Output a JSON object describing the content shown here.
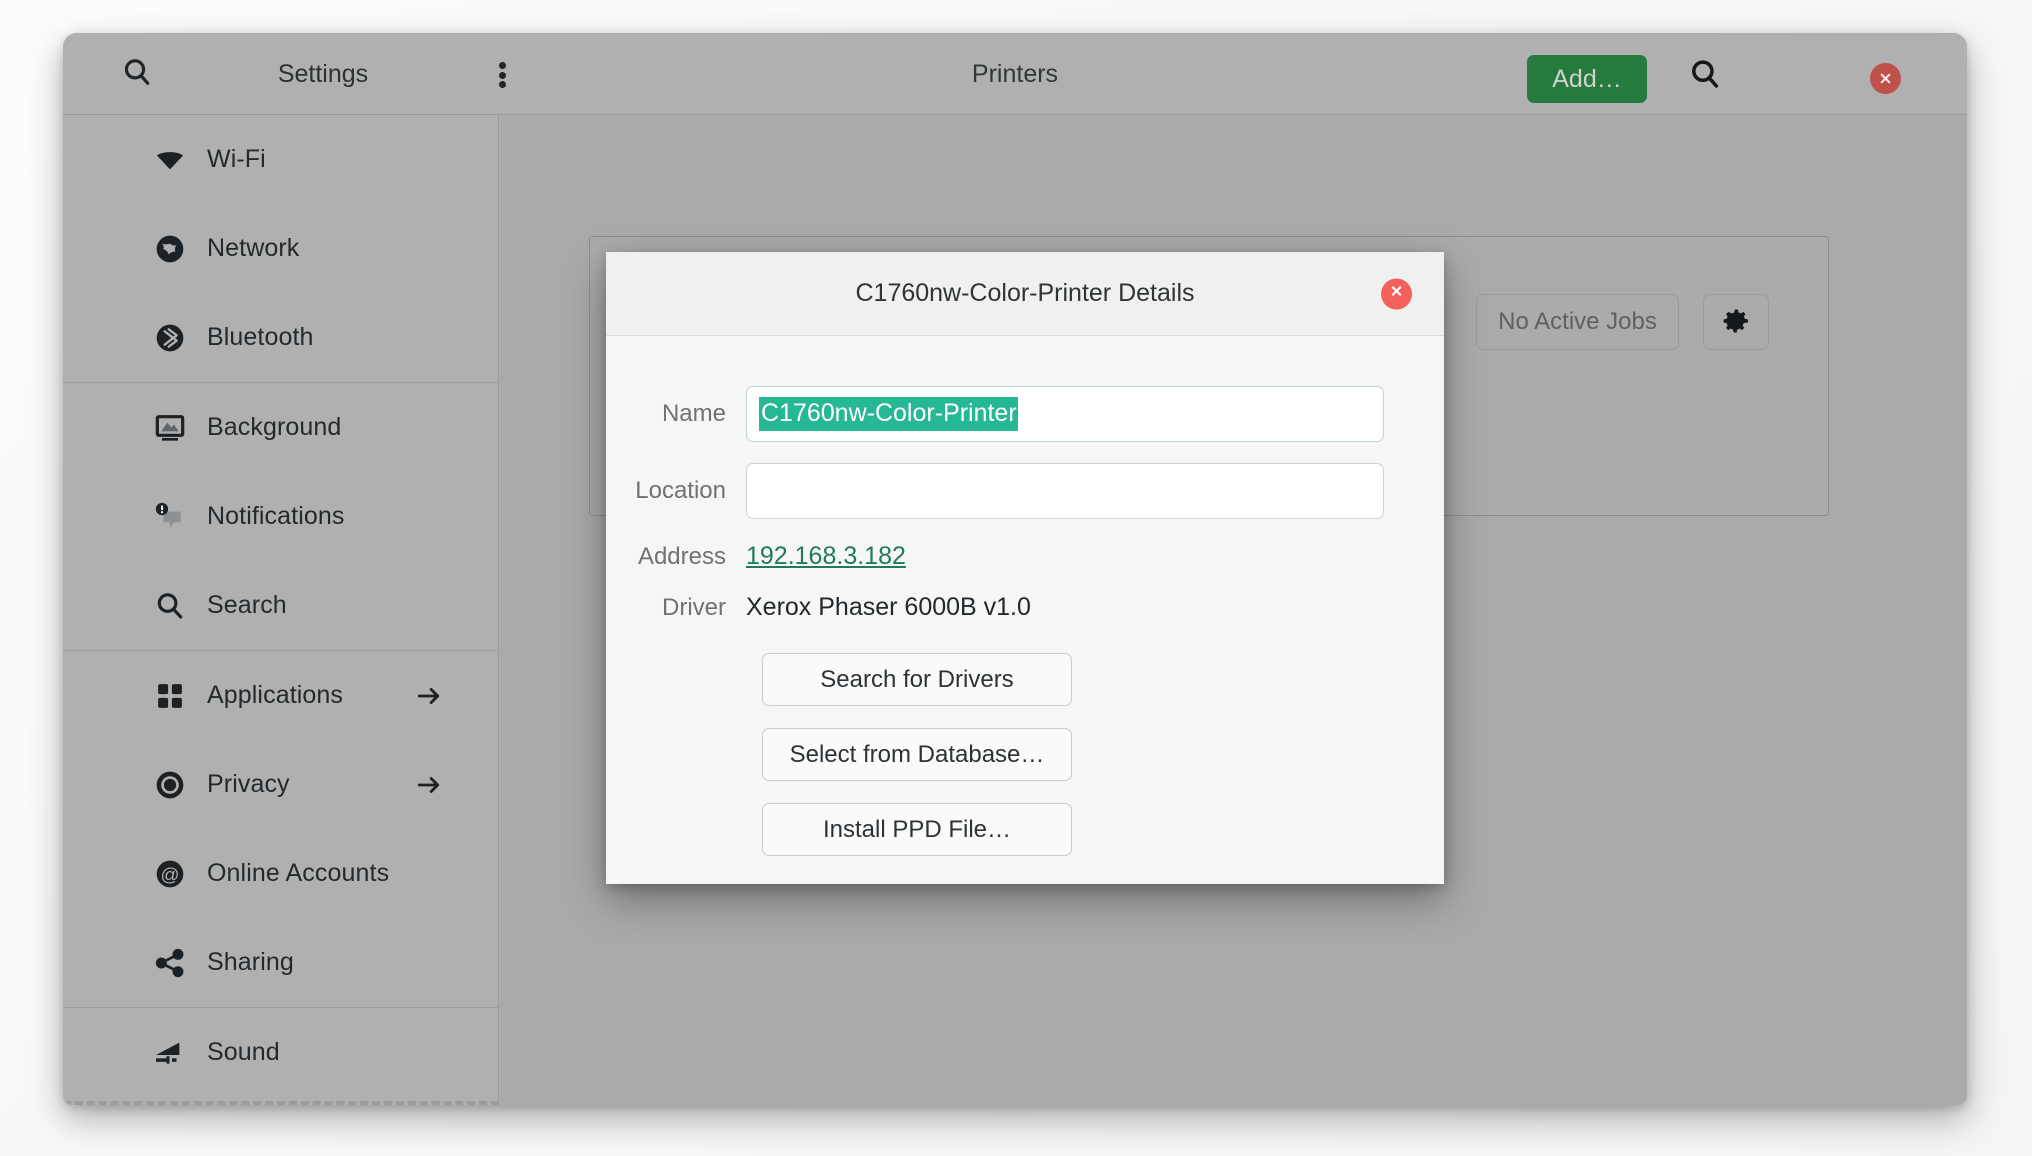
{
  "header": {
    "app_title": "Settings",
    "page_title": "Printers",
    "add_button": "Add…",
    "search_icon": "search-icon",
    "menu_icon": "kebab-menu-icon",
    "search_right_icon": "search-icon",
    "close_icon": "window-close-icon",
    "add_button_color": "#257a3e",
    "close_button_color": "#c0504a"
  },
  "sidebar": {
    "groups": [
      {
        "items": [
          {
            "label": "Wi-Fi",
            "icon": "wifi-icon",
            "arrow": false
          },
          {
            "label": "Network",
            "icon": "globe-icon",
            "arrow": false
          },
          {
            "label": "Bluetooth",
            "icon": "bluetooth-icon",
            "arrow": false
          }
        ]
      },
      {
        "items": [
          {
            "label": "Background",
            "icon": "monitor-icon",
            "arrow": false
          },
          {
            "label": "Notifications",
            "icon": "notification-bubble-icon",
            "arrow": false
          },
          {
            "label": "Search",
            "icon": "search-icon",
            "arrow": false
          }
        ]
      },
      {
        "items": [
          {
            "label": "Applications",
            "icon": "grid-squares-icon",
            "arrow": true
          },
          {
            "label": "Privacy",
            "icon": "target-circle-icon",
            "arrow": true
          },
          {
            "label": "Online Accounts",
            "icon": "at-sign-icon",
            "arrow": false
          },
          {
            "label": "Sharing",
            "icon": "share-nodes-icon",
            "arrow": false
          }
        ]
      },
      {
        "items": [
          {
            "label": "Sound",
            "icon": "volume-icon",
            "arrow": false
          }
        ]
      }
    ]
  },
  "content": {
    "jobs_button": "No Active Jobs",
    "gear_icon": "gear-icon"
  },
  "dialog": {
    "title": "C1760nw-Color-Printer Details",
    "close_icon": "dialog-close-icon",
    "close_color": "#f4615d",
    "selection_color": "#26b795",
    "link_color": "#1f7a5f",
    "fields": {
      "name_label": "Name",
      "name_value": "C1760nw-Color-Printer",
      "name_placeholder": "",
      "location_label": "Location",
      "location_value": "",
      "location_placeholder": "",
      "address_label": "Address",
      "address_value": "192.168.3.182",
      "driver_label": "Driver",
      "driver_value": "Xerox Phaser 6000B v1.0"
    },
    "buttons": [
      "Search for Drivers",
      "Select from Database…",
      "Install PPD File…"
    ]
  }
}
